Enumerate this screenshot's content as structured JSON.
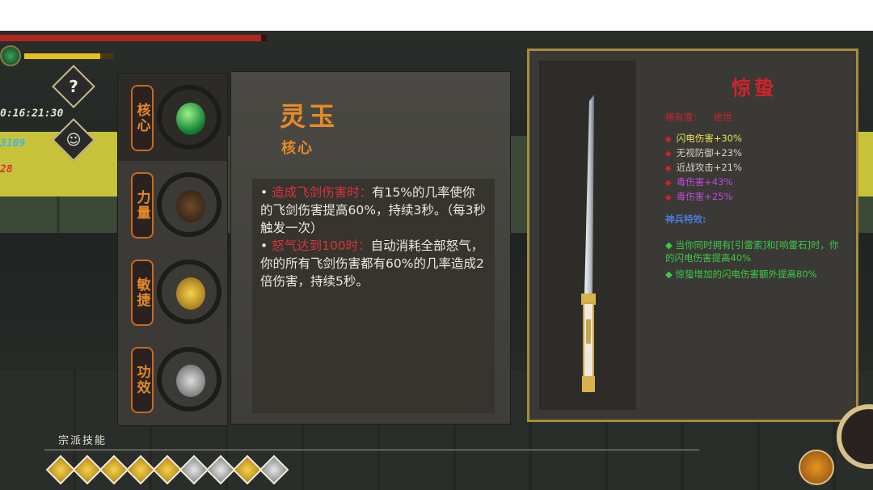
{
  "hud": {
    "timer": "0:16:21:30",
    "kills": "3109",
    "coins": "28",
    "help_icon": "question-mark-icon",
    "character_icon": "character-silhouette-icon",
    "hp_fraction": 0.98,
    "rage_fraction": 0.85
  },
  "tabs": [
    {
      "label": "核心",
      "icon": "jade-gem-icon",
      "active": true
    },
    {
      "label": "力量",
      "icon": "chain-icon",
      "active": false
    },
    {
      "label": "敏捷",
      "icon": "golden-seal-icon",
      "active": false
    },
    {
      "label": "功效",
      "icon": "ore-icon",
      "active": false
    }
  ],
  "detail": {
    "name": "灵玉",
    "type": "核心",
    "lines": [
      {
        "bullet": "•",
        "trigger": "造成飞剑伤害时：",
        "text": "有15%的几率使你的飞剑伤害提高60%，持续3秒。（每3秒触发一次）"
      },
      {
        "bullet": "•",
        "trigger": "怒气达到100时：",
        "text": "自动消耗全部怒气，你的所有飞剑伤害都有60%的几率造成2倍伤害，持续5秒。"
      }
    ]
  },
  "card": {
    "title": "惊蛰",
    "rarity_label": "稀有度：",
    "rarity_value": "绝世",
    "stats": [
      {
        "text": "闪电伤害+30%",
        "color": "#e8e05a"
      },
      {
        "text": "无视防御+23%",
        "color": "#d8d2c2"
      },
      {
        "text": "近战攻击+21%",
        "color": "#d8d2c2"
      },
      {
        "text": "毒伤害+43%",
        "color": "#c04ad8"
      },
      {
        "text": "毒伤害+25%",
        "color": "#c04ad8"
      }
    ],
    "special_header": "神兵特效:",
    "specials": [
      {
        "text": "当你同时拥有[引雷索]和[响雷石]时，你的闪电伤害提高40%"
      },
      {
        "text": "惊蛰增加的闪电伤害额外提高80%"
      }
    ],
    "weapon_icon": "sword-icon"
  },
  "skillbar": {
    "label": "宗派技能",
    "skills": [
      {
        "icon": "skill-1-icon",
        "active": true
      },
      {
        "icon": "skill-2-icon",
        "active": true
      },
      {
        "icon": "skill-3-icon",
        "active": true
      },
      {
        "icon": "skill-4-icon",
        "active": true
      },
      {
        "icon": "skill-5-icon",
        "active": true
      },
      {
        "icon": "skill-6-icon",
        "active": false
      },
      {
        "icon": "skill-7-icon",
        "active": false
      },
      {
        "icon": "skill-8-icon",
        "active": true
      },
      {
        "icon": "skill-9-icon",
        "active": false
      }
    ],
    "corner_icon": "lightning-orb-icon"
  },
  "colors": {
    "orange": "#e58b2a",
    "red": "#d2232b",
    "gold": "#e5c21a",
    "green": "#3cc94a",
    "blue": "#4a7ad8"
  }
}
